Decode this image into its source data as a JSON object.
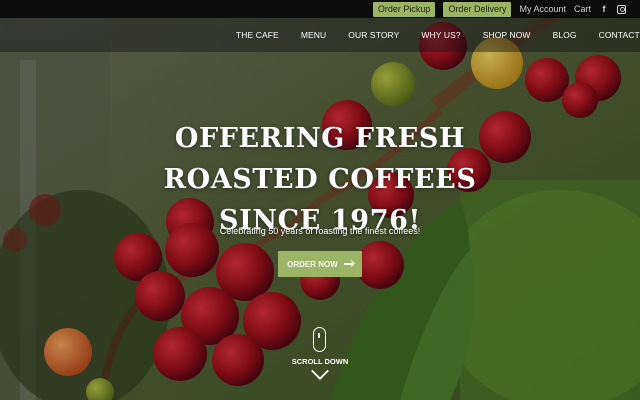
{
  "topbar": {
    "order_pickup": "Order Pickup",
    "order_delivery": "Order Delivery",
    "my_account": "My Account",
    "cart": "Cart",
    "social": [
      {
        "icon": "facebook-icon",
        "glyph": "f"
      },
      {
        "icon": "instagram-icon"
      }
    ]
  },
  "nav": {
    "items": [
      {
        "label": "THE CAFE"
      },
      {
        "label": "MENU"
      },
      {
        "label": "OUR STORY"
      },
      {
        "label": "WHY US?"
      },
      {
        "label": "SHOP NOW"
      },
      {
        "label": "BLOG"
      },
      {
        "label": "CONTACT US"
      }
    ]
  },
  "hero": {
    "headline_line1": "OFFERING FRESH",
    "headline_line2": "ROASTED COFFEES",
    "headline_line3": "SINCE 1976!",
    "subtitle": "Celebrating 50 years of roasting the finest coffees!",
    "cta_label": "ORDER NOW",
    "scroll_label": "SCROLL DOWN"
  },
  "colors": {
    "accent": "#9bb466",
    "topbar_bg": "#0c0c0c",
    "text": "#ffffff"
  }
}
